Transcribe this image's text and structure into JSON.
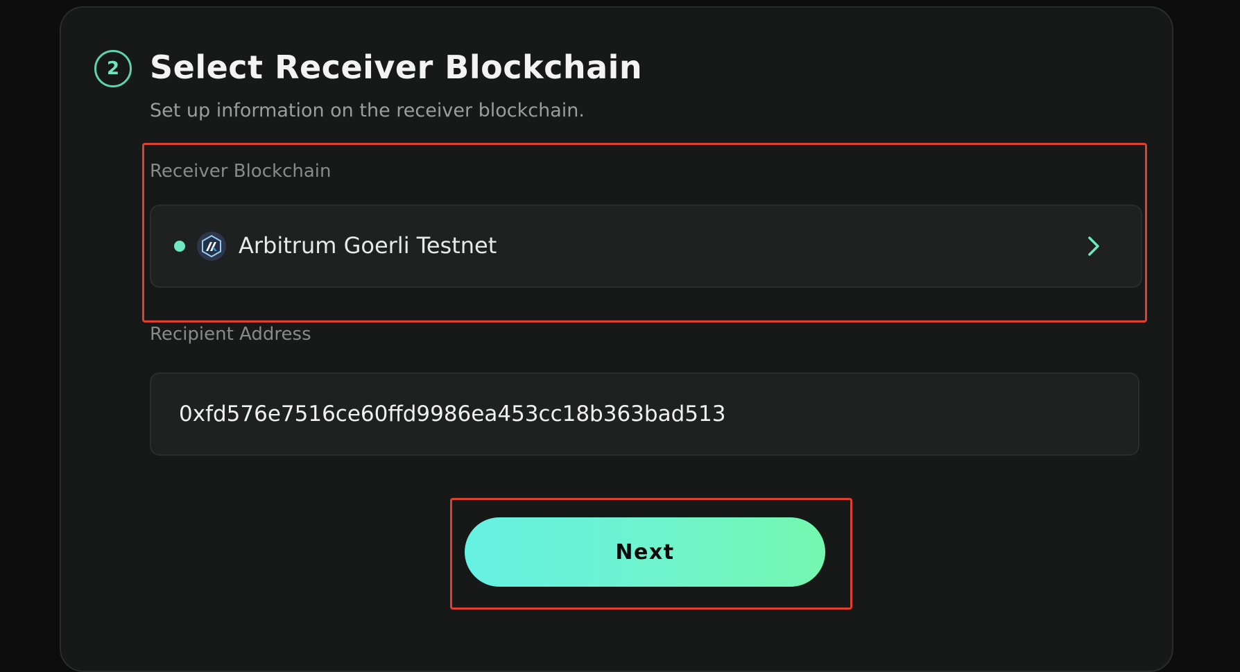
{
  "step": {
    "number": "2",
    "title": "Select Receiver Blockchain",
    "subtitle": "Set up information on the receiver blockchain."
  },
  "receiver_blockchain": {
    "label": "Receiver Blockchain",
    "selected": "Arbitrum Goerli Testnet",
    "status": "connected",
    "logo_icon": "arbitrum-logo-icon",
    "chevron_icon": "chevron-right-icon"
  },
  "recipient": {
    "label": "Recipient Address",
    "value": "0xfd576e7516ce60ffd9986ea453cc18b363bad513"
  },
  "actions": {
    "next_label": "Next"
  },
  "colors": {
    "accent": "#6ee8c3",
    "highlight": "#e0412e",
    "background": "#0d0d0d",
    "card": "#171818"
  }
}
